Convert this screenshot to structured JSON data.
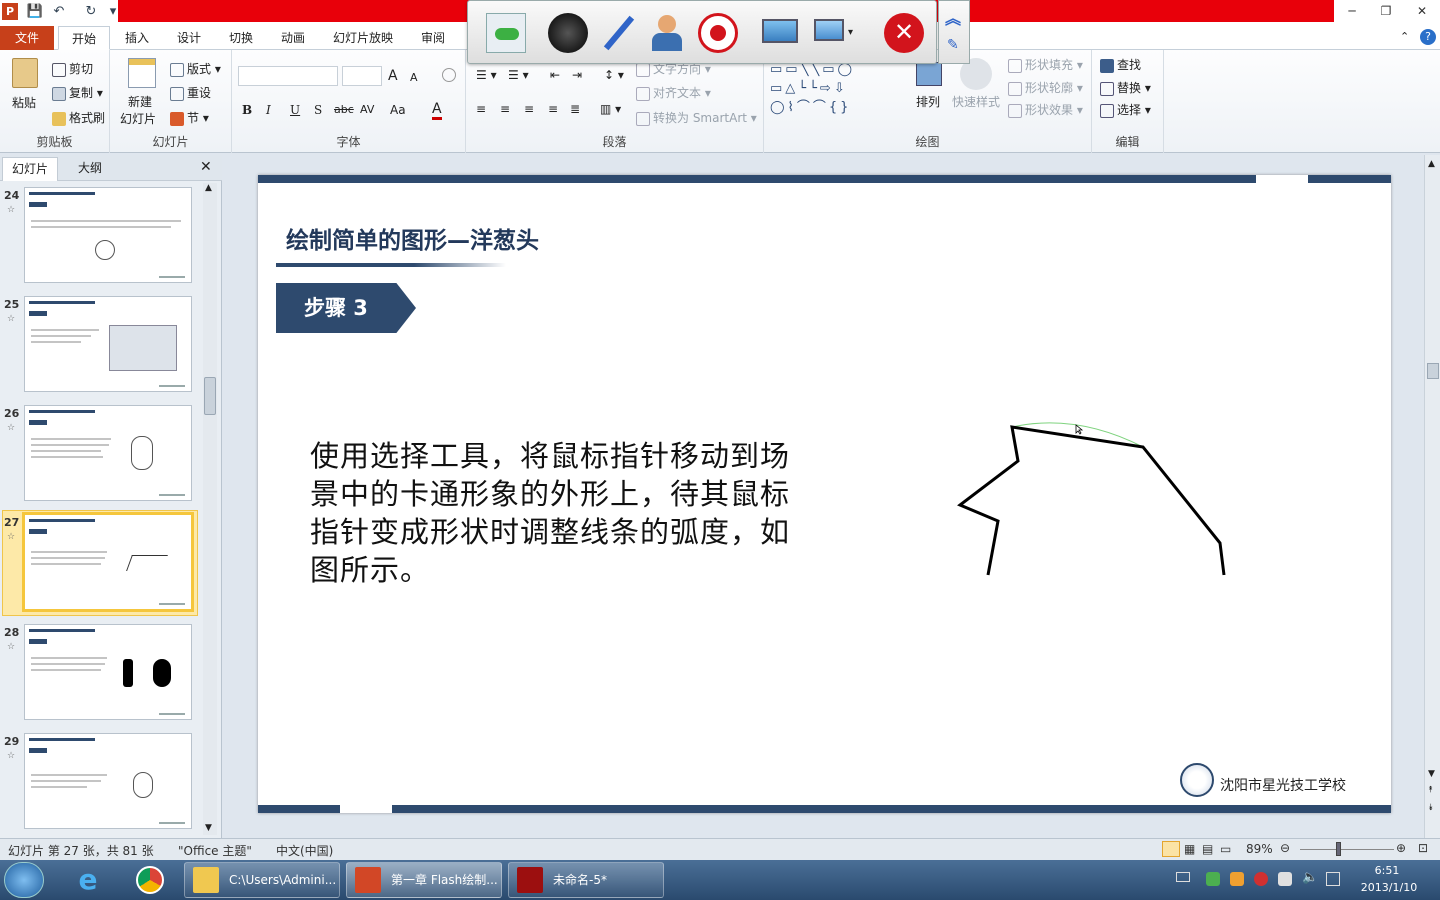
{
  "title_bar": {
    "app_icon": "P",
    "quick_access": [
      "save-icon",
      "undo-icon",
      "redo-icon",
      "customize-icon"
    ],
    "window_controls": [
      "─",
      "❐",
      "✕"
    ]
  },
  "ribbon_tabs": [
    "文件",
    "开始",
    "插入",
    "设计",
    "切换",
    "动画",
    "幻灯片放映",
    "审阅"
  ],
  "ribbon": {
    "clipboard": {
      "paste": "粘贴",
      "cut": "剪切",
      "copy": "复制",
      "format_painter": "格式刷",
      "label": "剪贴板"
    },
    "slides": {
      "new_slide_1": "新建",
      "new_slide_2": "幻灯片",
      "layout": "版式",
      "reset": "重设",
      "section": "节",
      "label": "幻灯片"
    },
    "font": {
      "label": "字体",
      "bold": "B",
      "italic": "I",
      "underline": "U",
      "shadow": "S",
      "strike": "abc",
      "spacing": "AV",
      "case": "Aa",
      "color": "A",
      "grow": "A",
      "shrink": "A"
    },
    "paragraph": {
      "text_direction": "文字方向",
      "align_text": "对齐文本",
      "smartart": "转换为 SmartArt",
      "label": "段落"
    },
    "drawing": {
      "arrange": "排列",
      "quick_styles": "快速样式",
      "shape_fill": "形状填充",
      "shape_outline": "形状轮廓",
      "shape_effects": "形状效果",
      "label": "绘图"
    },
    "editing": {
      "find": "查找",
      "replace": "替换",
      "select": "选择",
      "label": "编辑"
    }
  },
  "panel_tabs": [
    "幻灯片",
    "大纲"
  ],
  "thumbnails": [
    {
      "num": "24",
      "star": "☆",
      "selected": false
    },
    {
      "num": "25",
      "star": "☆",
      "selected": false
    },
    {
      "num": "26",
      "star": "☆",
      "selected": false
    },
    {
      "num": "27",
      "star": "☆",
      "selected": true
    },
    {
      "num": "28",
      "star": "☆",
      "selected": false
    },
    {
      "num": "29",
      "star": "☆",
      "selected": false
    }
  ],
  "slide": {
    "title": "绘制简单的图形—洋葱头",
    "step": "步骤 3",
    "body": "使用选择工具，将鼠标指针移动到场景中的卡通形象的外形上，待其鼠标指针变成形状时调整线条的弧度，如图所示。",
    "school": "沈阳市星光技工学校"
  },
  "status": {
    "slide_info": "幻灯片 第 27 张，共 81 张",
    "theme": "\"Office 主题\"",
    "language": "中文(中国)",
    "zoom": "89%"
  },
  "taskbar": {
    "tasks": [
      {
        "label": "C:\\Users\\Admini..."
      },
      {
        "label": "第一章 Flash绘制..."
      },
      {
        "label": "未命名-5*"
      }
    ],
    "time": "6:51",
    "date": "2013/1/10"
  },
  "colors": {
    "accent": "#2e4a6e",
    "file_tab": "#c7401a",
    "red_bar": "#e8000a",
    "selected_thumb": "#f5c63c"
  }
}
